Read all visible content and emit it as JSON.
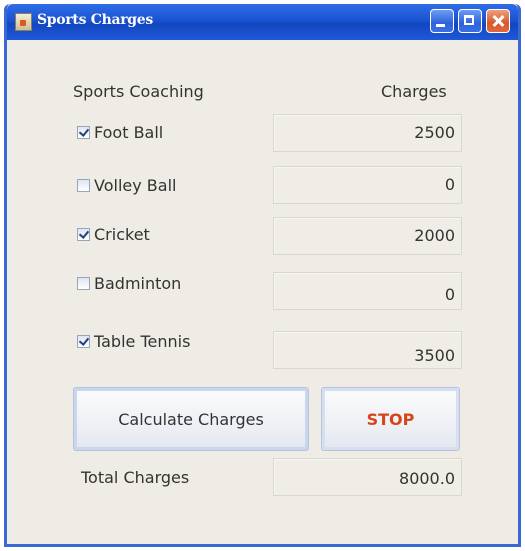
{
  "window": {
    "title": "Sports Charges"
  },
  "headers": {
    "left": "Sports Coaching",
    "right": "Charges"
  },
  "sports": [
    {
      "label": "Foot Ball",
      "checked": true,
      "charge": "2500"
    },
    {
      "label": "Volley Ball",
      "checked": false,
      "charge": "0"
    },
    {
      "label": "Cricket",
      "checked": true,
      "charge": "2000"
    },
    {
      "label": "Badminton",
      "checked": false,
      "charge": "0"
    },
    {
      "label": "Table Tennis",
      "checked": true,
      "charge": "3500"
    }
  ],
  "buttons": {
    "calculate": "Calculate Charges",
    "stop": "STOP"
  },
  "total": {
    "label": "Total Charges",
    "value": "8000.0"
  },
  "colors": {
    "titlebar": "#1a53d2",
    "stop_text": "#d6441a",
    "panel_bg": "#eeece4"
  }
}
